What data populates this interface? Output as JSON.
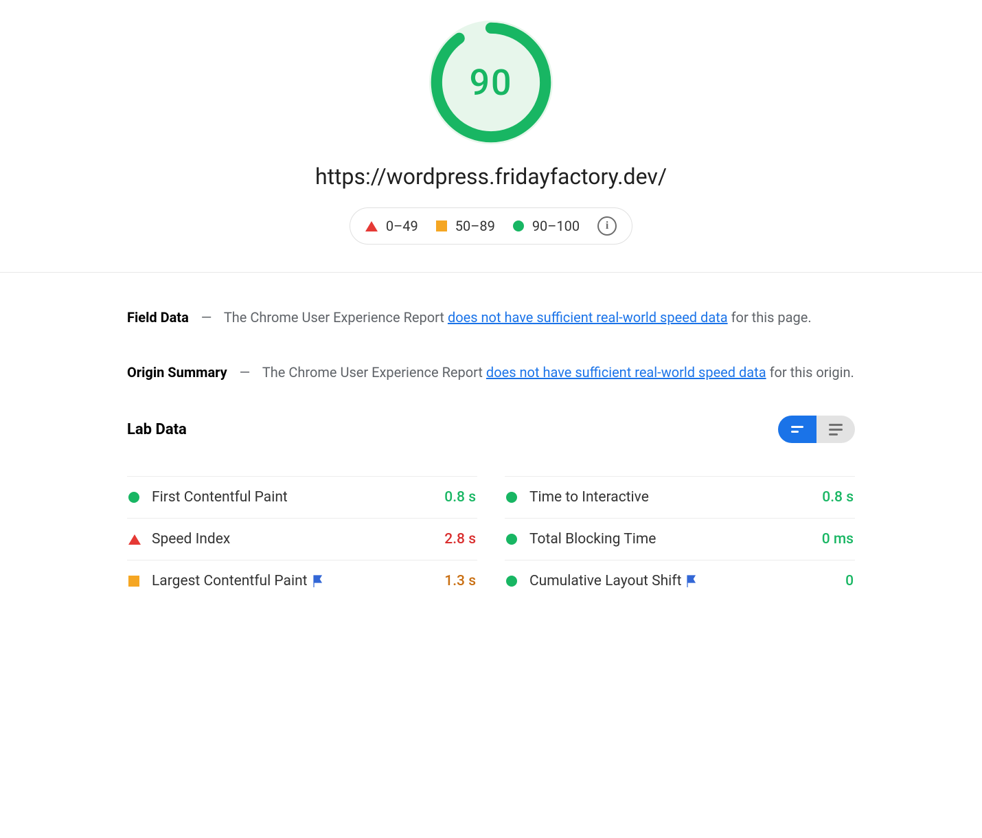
{
  "score": "90",
  "url": "https://wordpress.fridayfactory.dev/",
  "legend": {
    "poor": "0–49",
    "average": "50–89",
    "good": "90–100"
  },
  "field_data": {
    "heading": "Field Data",
    "prefix": "The Chrome User Experience Report ",
    "link": "does not have sufficient real-world speed data",
    "suffix": " for this page."
  },
  "origin_summary": {
    "heading": "Origin Summary",
    "prefix": "The Chrome User Experience Report ",
    "link": "does not have sufficient real-world speed data",
    "suffix": " for this origin."
  },
  "lab_data_heading": "Lab Data",
  "metrics_left": [
    {
      "name": "First Contentful Paint",
      "value": "0.8 s",
      "status": "good",
      "flag": false
    },
    {
      "name": "Speed Index",
      "value": "2.8 s",
      "status": "poor",
      "flag": false
    },
    {
      "name": "Largest Contentful Paint",
      "value": "1.3 s",
      "status": "average",
      "flag": true
    }
  ],
  "metrics_right": [
    {
      "name": "Time to Interactive",
      "value": "0.8 s",
      "status": "good",
      "flag": false
    },
    {
      "name": "Total Blocking Time",
      "value": "0 ms",
      "status": "good",
      "flag": false
    },
    {
      "name": "Cumulative Layout Shift",
      "value": "0",
      "status": "good",
      "flag": true
    }
  ],
  "colors": {
    "good": "#18b663",
    "average": "#f5a623",
    "poor": "#e53935",
    "link": "#1a73e8"
  }
}
